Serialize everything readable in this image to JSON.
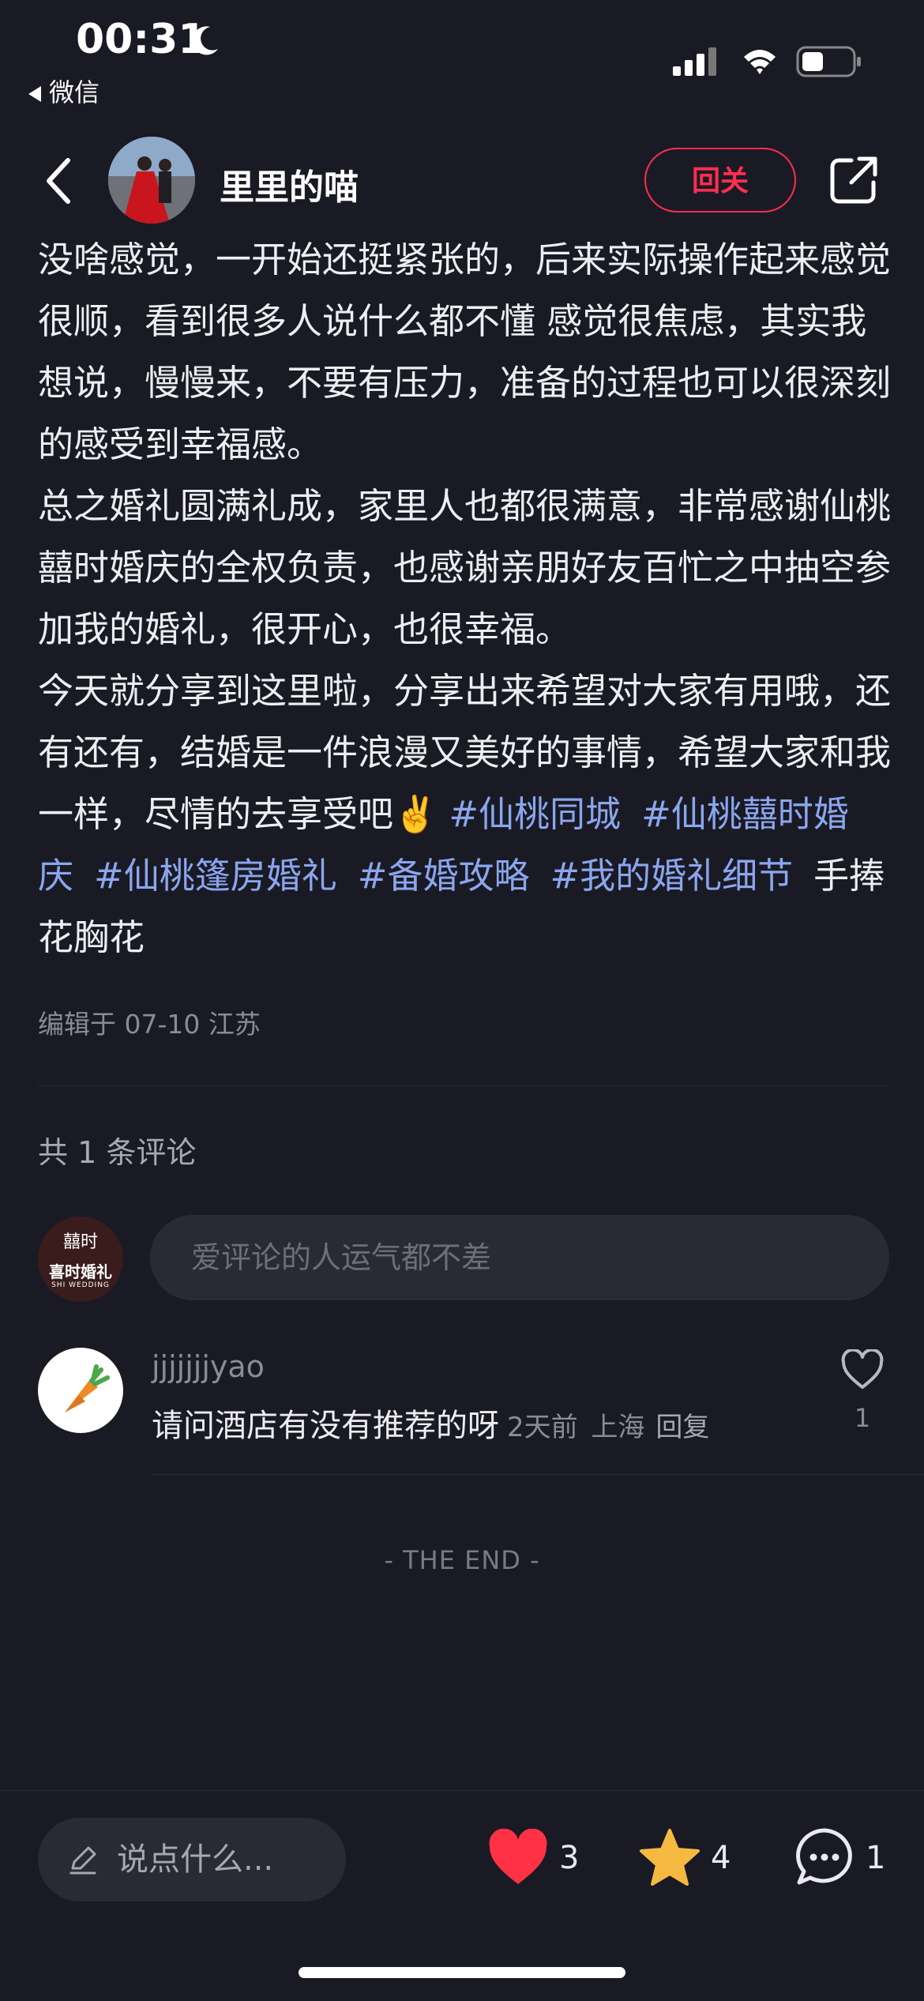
{
  "status_bar": {
    "time": "00:31",
    "back_app": "微信"
  },
  "nav": {
    "author_name": "里里的喵",
    "follow_label": "回关"
  },
  "post": {
    "paragraphs": [
      "没啥感觉，一开始还挺紧张的，后来实际操作起来感觉很顺，看到很多人说什么都不懂 感觉很焦虑，其实我想说，慢慢来，不要有压力，准备的过程也可以很深刻的感受到幸福感。",
      "总之婚礼圆满礼成，家里人也都很满意，非常感谢仙桃囍时婚庆的全权负责，也感谢亲朋好友百忙之中抽空参加我的婚礼，很开心，也很幸福。",
      "今天就分享到这里啦，分享出来希望对大家有用哦，还有还有，结婚是一件浪漫又美好的事情，希望大家和我一样，尽情的去享受吧✌️"
    ],
    "tags": [
      "#仙桃同城",
      "#仙桃囍时婚庆",
      "#仙桃篷房婚礼",
      "#备婚攻略",
      "#我的婚礼细节"
    ],
    "extra_tag": "手捧花胸花",
    "meta": "编辑于 07-10 江苏"
  },
  "comments": {
    "count_label": "共 1 条评论",
    "my_avatar_text": "喜时婚礼",
    "my_avatar_top": "囍时",
    "my_avatar_sub": "SHI WEDDING",
    "input_placeholder": "爱评论的人运气都不差",
    "items": [
      {
        "user": "jjjjjjjyao",
        "text": "请问酒店有没有推荐的呀",
        "time": "2天前",
        "location": "上海",
        "reply_label": "回复",
        "likes": "1"
      }
    ],
    "end_label": "- THE END -"
  },
  "bottom_bar": {
    "say_placeholder": "说点什么...",
    "likes": "3",
    "stars": "4",
    "comments": "1"
  },
  "colors": {
    "background": "#1a1a24",
    "accent_red": "#ff2e50",
    "tag_blue": "#8aa6ee",
    "star_yellow": "#f5b942"
  }
}
